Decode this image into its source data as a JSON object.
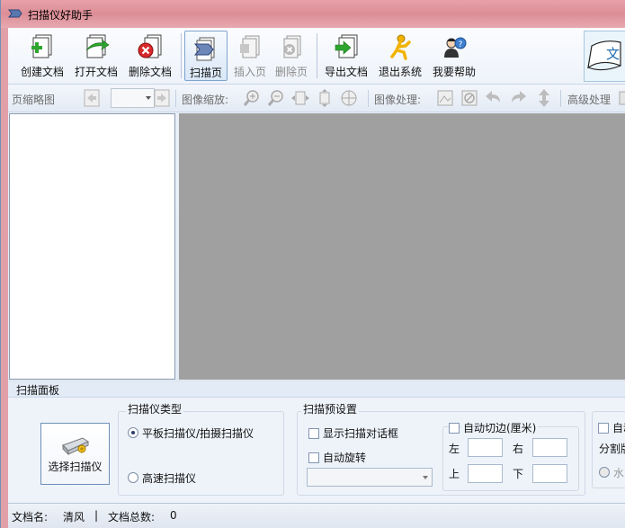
{
  "window": {
    "title": "扫描仪好助手"
  },
  "toolbar": {
    "create_doc": "创建文档",
    "open_doc": "打开文档",
    "delete_doc": "删除文档",
    "scan_page": "扫描页",
    "insert_page": "插入页",
    "delete_page": "删除页",
    "export_doc": "导出文档",
    "exit_system": "退出系统",
    "help": "我要帮助"
  },
  "toolbar2": {
    "page_thumbnail": "页缩略图",
    "image_zoom": "图像缩放:",
    "image_process": "图像处理:",
    "advanced_process": "高级处理"
  },
  "scan_panel": {
    "title": "扫描面板",
    "select_scanner_button": "选择扫描仪",
    "scanner_type": {
      "title": "扫描仪类型",
      "options": [
        "平板扫描仪/拍摄扫描仪",
        "高速扫描仪"
      ],
      "selected": "平板扫描仪/拍摄扫描仪"
    },
    "scan_preset": {
      "title": "扫描预设置",
      "show_dialog": "显示扫描对话框",
      "auto_rotate": "自动旋转",
      "auto_crop": "自动切边(厘米)",
      "left": "左",
      "right": "右",
      "top": "上",
      "bottom": "下"
    },
    "partial": {
      "auto": "自动",
      "split": "分割版",
      "level": "水"
    }
  },
  "status": {
    "doc_name_label": "文档名:",
    "doc_name_value": "清风",
    "separator": "|",
    "doc_total_label": "文档总数:",
    "doc_total_value": "0"
  }
}
